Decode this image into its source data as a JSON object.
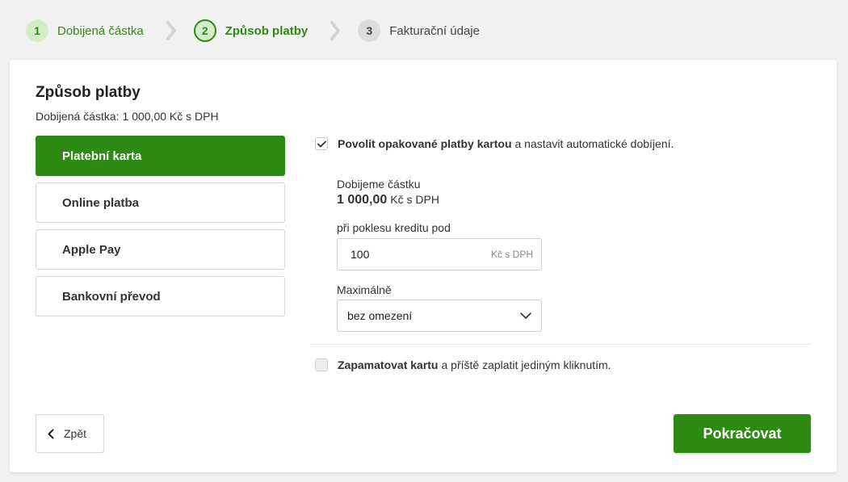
{
  "stepper": {
    "steps": [
      {
        "number": "1",
        "label": "Dobijená částka",
        "state": "done"
      },
      {
        "number": "2",
        "label": "Způsob platby",
        "state": "active"
      },
      {
        "number": "3",
        "label": "Fakturační údaje",
        "state": "todo"
      }
    ]
  },
  "card": {
    "title": "Způsob platby",
    "subtitle_label": "Dobijená částka:",
    "subtitle_value": "1 000,00 Kč s DPH"
  },
  "methods": [
    {
      "label": "Platební karta",
      "selected": true
    },
    {
      "label": "Online platba",
      "selected": false
    },
    {
      "label": "Apple Pay",
      "selected": false
    },
    {
      "label": "Bankovní převod",
      "selected": false
    }
  ],
  "recurring": {
    "checked": true,
    "bold": "Povolit opakované platby kartou",
    "rest": "a nastavit automatické dobíjení."
  },
  "autofill": {
    "amount_label": "Dobijeme částku",
    "amount_value": "1 000,00",
    "amount_unit": "Kč s DPH",
    "threshold_label": "při poklesu kreditu pod",
    "threshold_value": "100",
    "threshold_unit": "Kč s DPH",
    "max_label": "Maximálně",
    "max_value": "bez omezení"
  },
  "remember": {
    "checked": false,
    "bold": "Zapamatovat kartu",
    "rest": "a příště zaplatit jediným kliknutím."
  },
  "actions": {
    "back_label": "Zpět",
    "next_label": "Pokračovat"
  },
  "colors": {
    "accent": "#2d8a12",
    "accent_light": "#d6ecc9"
  }
}
